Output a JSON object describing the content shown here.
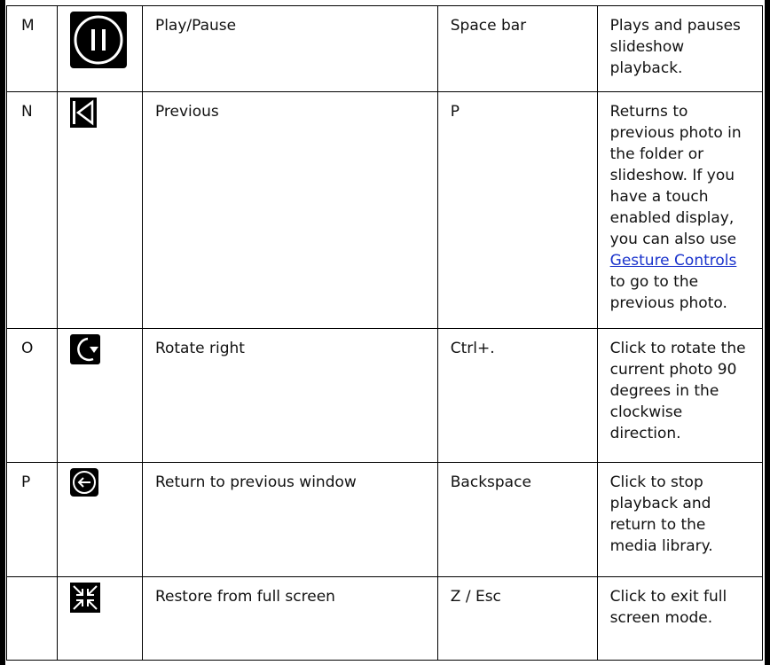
{
  "rows": [
    {
      "id": "M",
      "icon": "play-pause-icon",
      "name": "Play/Pause",
      "shortcut": "Space bar",
      "description": "Plays and pauses slideshow playback."
    },
    {
      "id": "N",
      "icon": "previous-icon",
      "name": "Previous",
      "shortcut": "P",
      "description_before": "Returns to previous photo in the folder or slideshow. If you have a touch enabled display, you can also use ",
      "description_link": "Gesture Controls",
      "description_after": " to go to the previous photo."
    },
    {
      "id": "O",
      "icon": "rotate-right-icon",
      "name": "Rotate right",
      "shortcut": "Ctrl+.",
      "description": "Click to rotate the current photo 90 degrees in the clockwise direction."
    },
    {
      "id": "P",
      "icon": "back-arrow-icon",
      "name": "Return to previous window",
      "shortcut": "Backspace",
      "description": "Click to stop playback and return to the media library."
    },
    {
      "id": "",
      "icon": "restore-fullscreen-icon",
      "name": "Restore from full screen",
      "shortcut": "Z / Esc",
      "description": "Click to exit full screen mode."
    }
  ],
  "colors": {
    "icon_bg": "#000000",
    "icon_fg": "#ffffff",
    "link": "#1a33cc"
  }
}
